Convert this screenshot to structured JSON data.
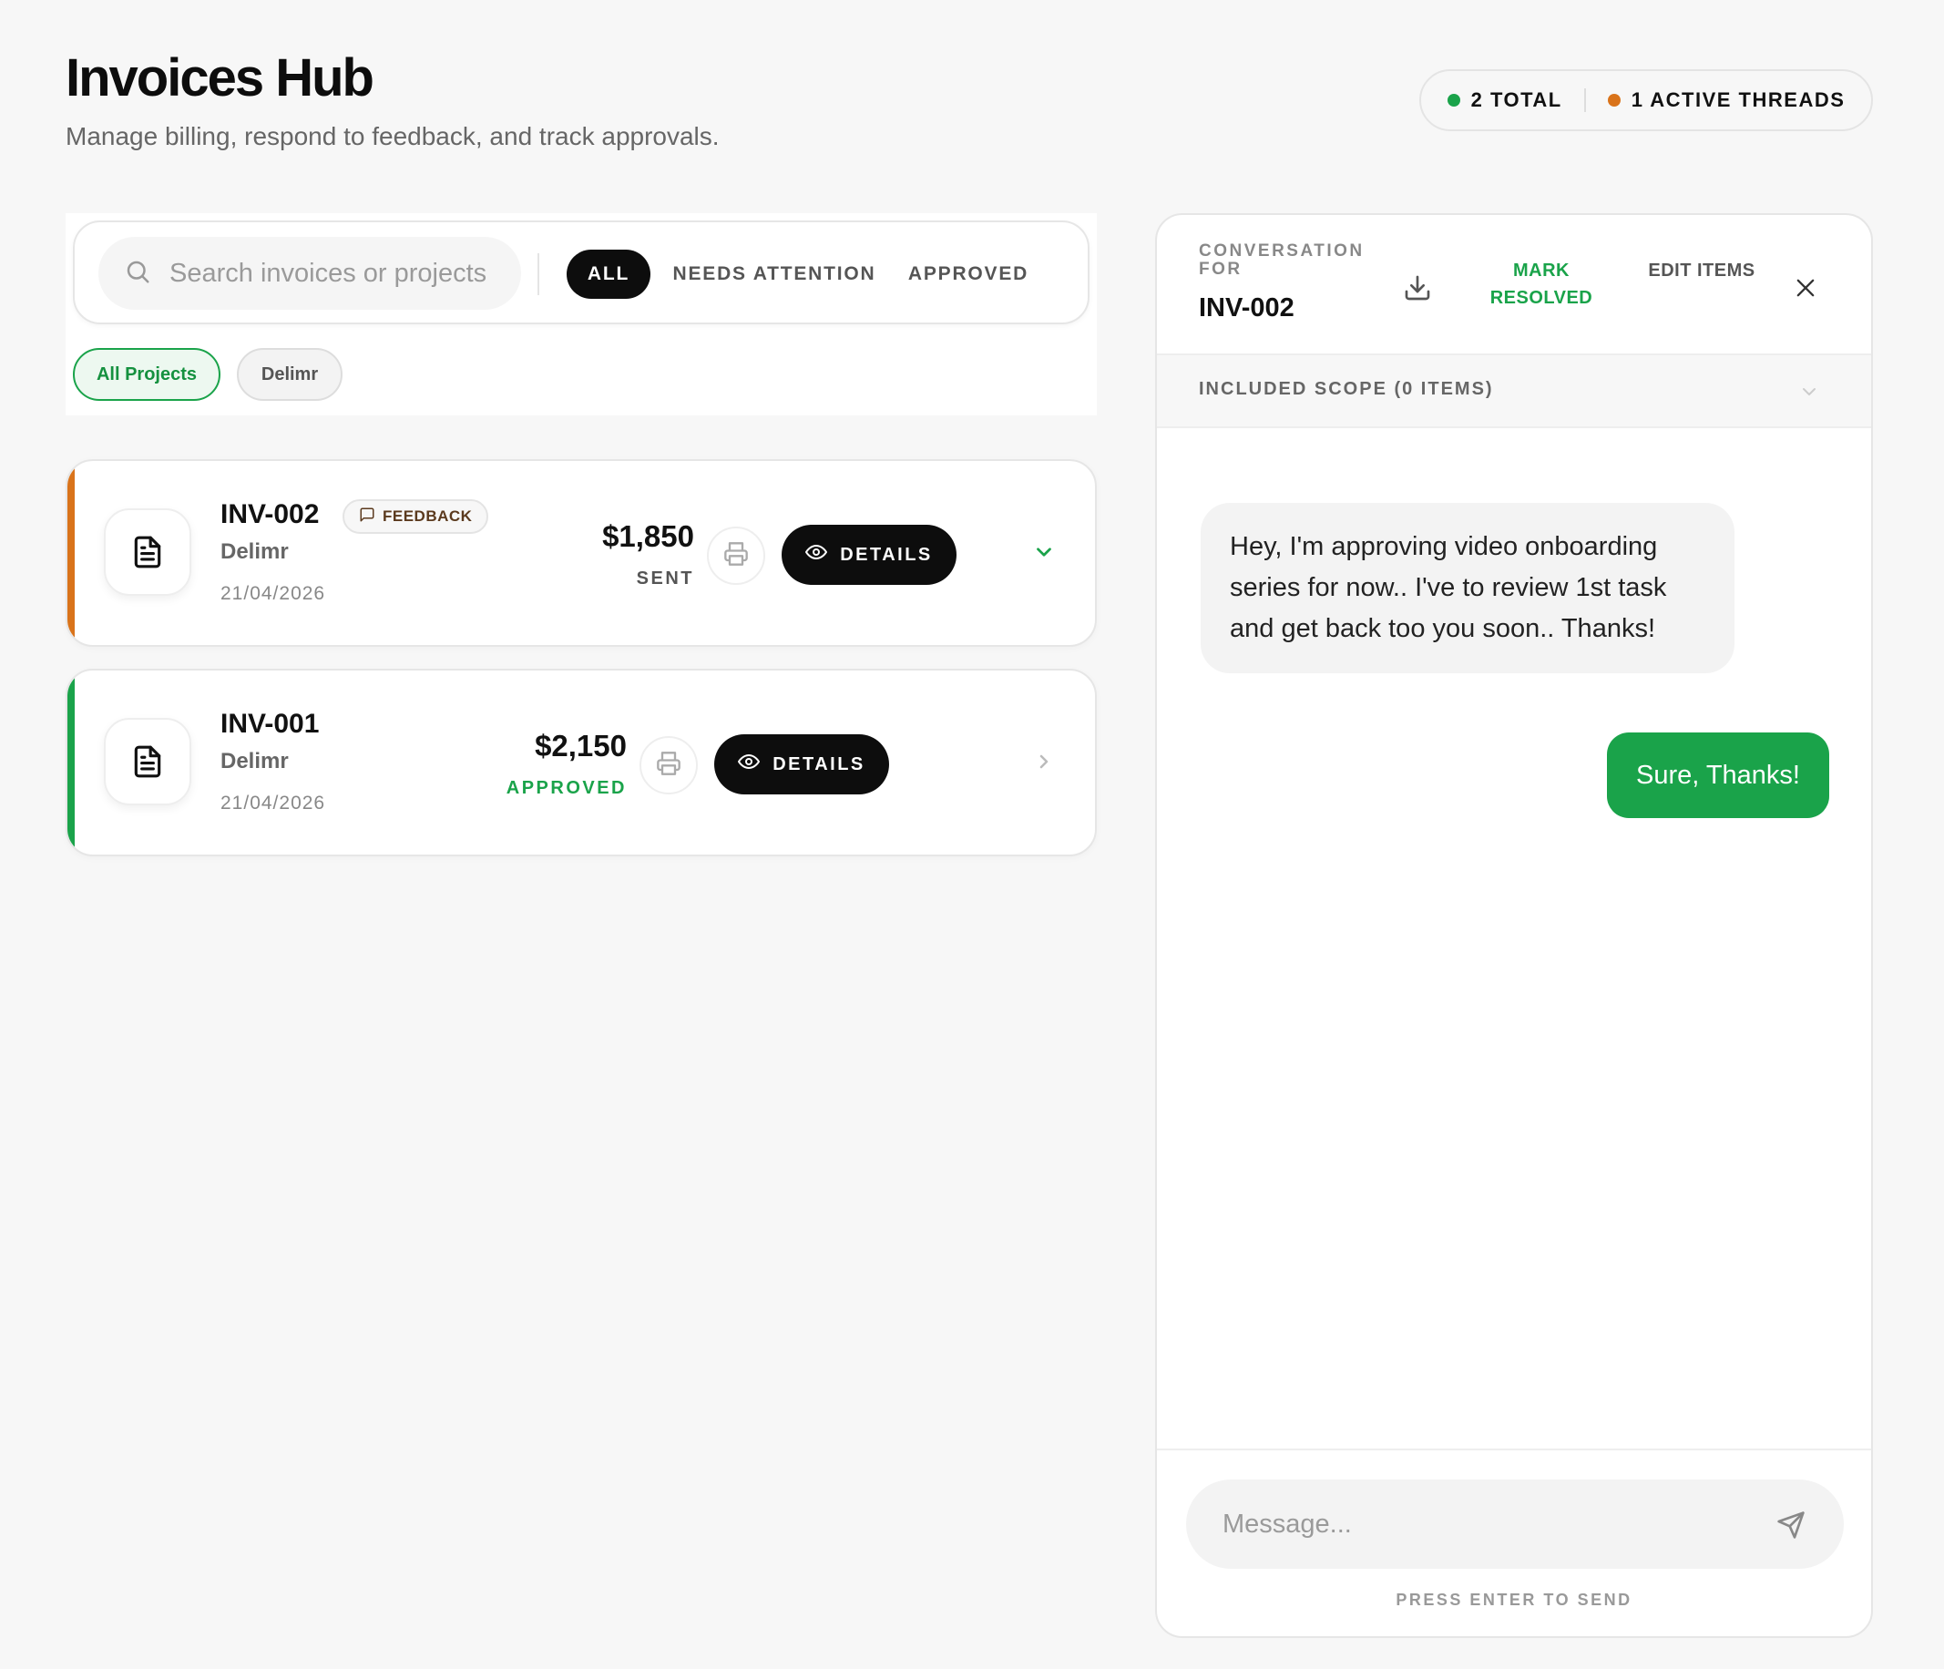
{
  "header": {
    "title": "Invoices Hub",
    "subtitle": "Manage billing, respond to feedback, and track approvals."
  },
  "stats": {
    "total_label": "2 TOTAL",
    "total_color": "#1aa34a",
    "active_label": "1 ACTIVE THREADS",
    "active_color": "#d9731a"
  },
  "filters": {
    "search_placeholder": "Search invoices or projects",
    "tabs": [
      "ALL",
      "NEEDS ATTENTION",
      "APPROVED"
    ],
    "active_tab": "ALL",
    "projects": [
      "All Projects",
      "Delimr"
    ],
    "active_project": "All Projects"
  },
  "invoices": [
    {
      "id": "INV-002",
      "badge": "FEEDBACK",
      "client": "Delimr",
      "date": "21/04/2026",
      "amount": "$1,850",
      "status": "SENT",
      "status_color": "#555555",
      "accent_color": "#d9731a",
      "details_label": "DETAILS",
      "expanded": true
    },
    {
      "id": "INV-001",
      "client": "Delimr",
      "date": "21/04/2026",
      "amount": "$2,150",
      "status": "APPROVED",
      "status_color": "#1aa34a",
      "accent_color": "#1aa34a",
      "details_label": "DETAILS",
      "expanded": false
    }
  ],
  "conversation": {
    "label": "CONVERSATION FOR",
    "invoice_id": "INV-002",
    "mark_resolved": "MARK RESOLVED",
    "edit_items": "EDIT ITEMS",
    "scope_label": "INCLUDED SCOPE (0 ITEMS)",
    "messages": [
      {
        "from": "client",
        "text": "Hey, I'm approving video onboarding series for now.. I've to review 1st task and get back too you soon.. Thanks!"
      },
      {
        "from": "me",
        "text": "Sure, Thanks!"
      }
    ],
    "composer_placeholder": "Message...",
    "hint": "PRESS ENTER TO SEND"
  }
}
